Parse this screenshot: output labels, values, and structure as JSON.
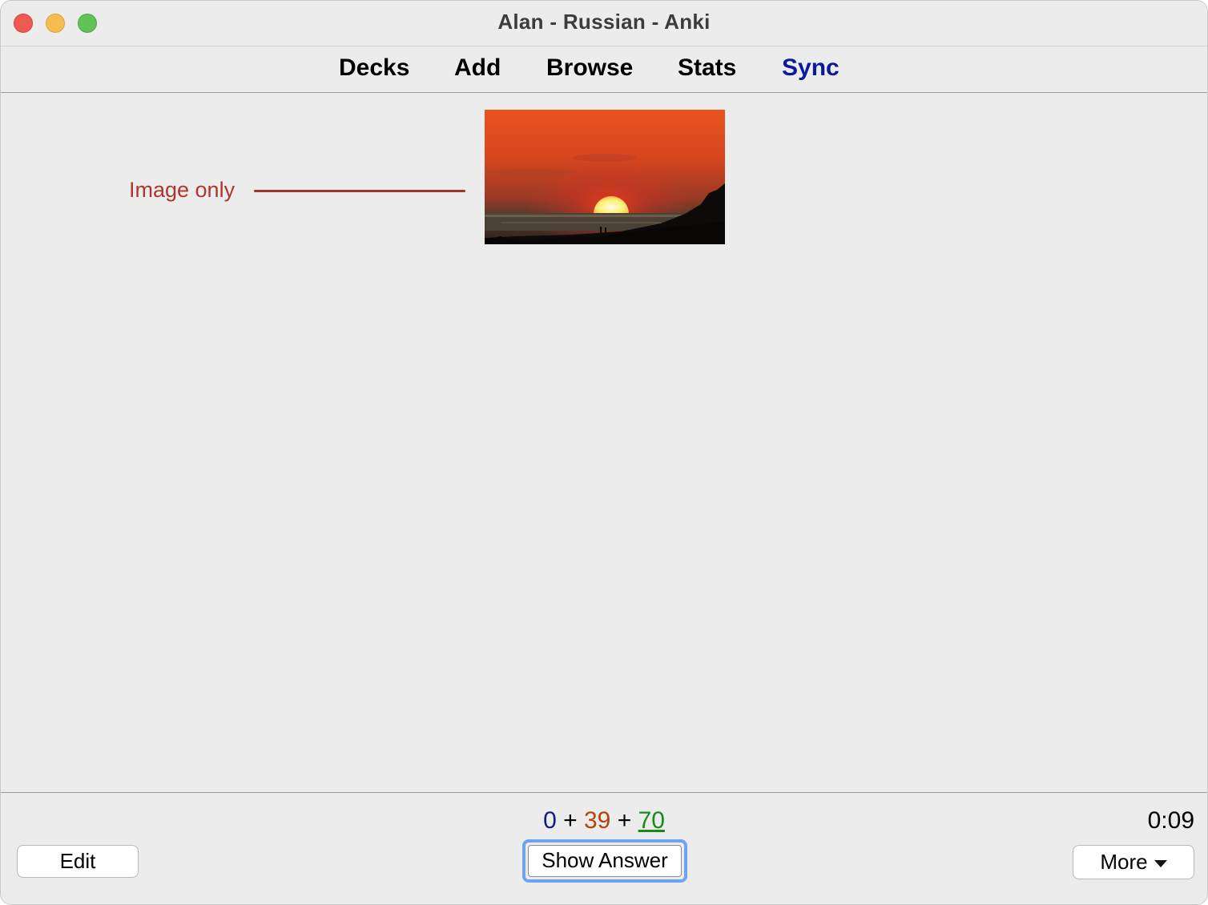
{
  "window": {
    "title": "Alan - Russian - Anki"
  },
  "toolbar": {
    "decks": "Decks",
    "add": "Add",
    "browse": "Browse",
    "stats": "Stats",
    "sync": "Sync",
    "sync_color": "#0a1a9e"
  },
  "card": {
    "image_icon": "sunset-photo",
    "annotation": "Image only",
    "annotation_color": "#b0362c"
  },
  "bottombar": {
    "counts": {
      "new": "0",
      "learn": "39",
      "review": "70",
      "sep": "+"
    },
    "count_colors": {
      "new": "#141a8e",
      "learn": "#b8420c",
      "review": "#1a8a1a"
    },
    "timer": "0:09",
    "edit_label": "Edit",
    "show_answer_label": "Show Answer",
    "more_label": "More"
  }
}
